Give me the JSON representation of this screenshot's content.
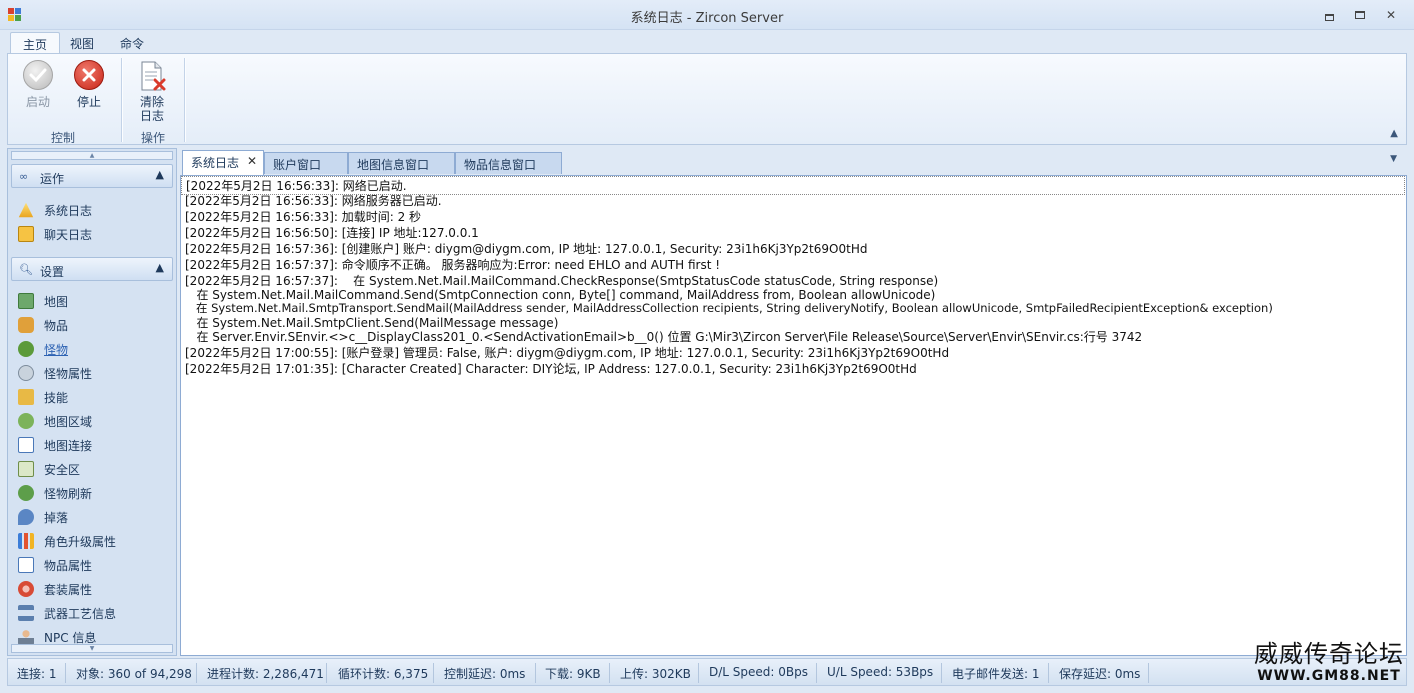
{
  "window": {
    "title": "系统日志 - Zircon Server",
    "controls": {
      "minimize": "▭",
      "maximize": "□",
      "close": "✕"
    }
  },
  "ribbon": {
    "tabs": [
      {
        "label": "主页",
        "active": true
      },
      {
        "label": "视图",
        "active": false
      },
      {
        "label": "命令",
        "active": false
      }
    ],
    "groups": [
      {
        "label": "控制",
        "buttons": [
          {
            "label": "启动",
            "icon": "check-circle-icon",
            "enabled": false
          },
          {
            "label": "停止",
            "icon": "stop-circle-icon",
            "enabled": true
          }
        ]
      },
      {
        "label": "操作",
        "buttons": [
          {
            "label": "清除日志",
            "line1": "清除",
            "line2": "日志",
            "icon": "clear-log-icon",
            "enabled": true
          }
        ]
      }
    ],
    "collapse_glyph": "▲"
  },
  "sidebar": {
    "groups": [
      {
        "label": "运作",
        "icon": "link-icon",
        "chevron": "▲",
        "items": [
          {
            "label": "系统日志",
            "icon": "warning-log-icon"
          },
          {
            "label": "聊天日志",
            "icon": "chat-log-icon"
          }
        ]
      },
      {
        "label": "设置",
        "icon": "search-icon",
        "chevron": "▲",
        "items": [
          {
            "label": "地图",
            "icon": "map-icon"
          },
          {
            "label": "物品",
            "icon": "item-icon"
          },
          {
            "label": "怪物",
            "icon": "monster-icon",
            "selected": true
          },
          {
            "label": "怪物属性",
            "icon": "monster-stats-icon"
          },
          {
            "label": "技能",
            "icon": "skill-icon"
          },
          {
            "label": "地图区域",
            "icon": "map-region-icon"
          },
          {
            "label": "地图连接",
            "icon": "map-link-icon"
          },
          {
            "label": "安全区",
            "icon": "safe-zone-icon"
          },
          {
            "label": "怪物刷新",
            "icon": "respawn-icon"
          },
          {
            "label": "掉落",
            "icon": "drop-icon"
          },
          {
            "label": "角色升级属性",
            "icon": "level-stats-icon"
          },
          {
            "label": "物品属性",
            "icon": "item-stats-icon"
          },
          {
            "label": "套装属性",
            "icon": "set-stats-icon"
          },
          {
            "label": "武器工艺信息",
            "icon": "weapon-craft-icon"
          },
          {
            "label": "NPC 信息",
            "icon": "npc-icon"
          }
        ]
      }
    ]
  },
  "documents": {
    "tabs": [
      {
        "label": "系统日志",
        "active": true,
        "close": "✕"
      },
      {
        "label": "账户窗口",
        "active": false
      },
      {
        "label": "地图信息窗口",
        "active": false
      },
      {
        "label": "物品信息窗口",
        "active": false
      }
    ],
    "dropdown_glyph": "▼"
  },
  "log": {
    "lines": [
      "[2022年5月2日 16:56:33]: 网络已启动.",
      "[2022年5月2日 16:56:33]: 网络服务器已启动.",
      "[2022年5月2日 16:56:33]: 加载时间: 2 秒",
      "[2022年5月2日 16:56:50]: [连接] IP 地址:127.0.0.1",
      "[2022年5月2日 16:57:36]: [创建账户] 账户: diygm@diygm.com, IP 地址: 127.0.0.1, Security: 23i1h6Kj3Yp2t69O0tHd",
      "[2022年5月2日 16:57:37]: 命令顺序不正确。 服务器响应为:Error: need EHLO and AUTH first !",
      "[2022年5月2日 16:57:37]:    在 System.Net.Mail.MailCommand.CheckResponse(SmtpStatusCode statusCode, String response)",
      "   在 System.Net.Mail.MailCommand.Send(SmtpConnection conn, Byte[] command, MailAddress from, Boolean allowUnicode)",
      "   在 System.Net.Mail.SmtpTransport.SendMail(MailAddress sender, MailAddressCollection recipients, String deliveryNotify, Boolean allowUnicode, SmtpFailedRecipientException& exception)",
      "   在 System.Net.Mail.SmtpClient.Send(MailMessage message)",
      "   在 Server.Envir.SEnvir.<>c__DisplayClass201_0.<SendActivationEmail>b__0() 位置 G:\\Mir3\\Zircon Server\\File Release\\Source\\Server\\Envir\\SEnvir.cs:行号 3742",
      "[2022年5月2日 17:00:55]: [账户登录] 管理员: False, 账户: diygm@diygm.com, IP 地址: 127.0.0.1, Security: 23i1h6Kj3Yp2t69O0tHd",
      "[2022年5月2日 17:01:35]: [Character Created] Character: DIY论坛, IP Address: 127.0.0.1, Security: 23i1h6Kj3Yp2t69O0tHd"
    ]
  },
  "status": {
    "items": [
      "连接: 1",
      "对象: 360 of 94,298",
      "进程计数: 2,286,471",
      "循环计数: 6,375",
      "控制延迟: 0ms",
      "下载: 9KB",
      "上传: 302KB",
      "D/L Speed: 0Bps",
      "U/L Speed: 53Bps",
      "电子邮件发送: 1",
      "保存延迟: 0ms"
    ]
  },
  "watermark": {
    "line1": "威威传奇论坛",
    "line2": "WWW.GM88.NET"
  },
  "colors": {
    "ribbon_bg": "#e4edf8",
    "accent": "#1e395b",
    "stop_red": "#d93a2b",
    "selected_link": "#2d62b3"
  }
}
